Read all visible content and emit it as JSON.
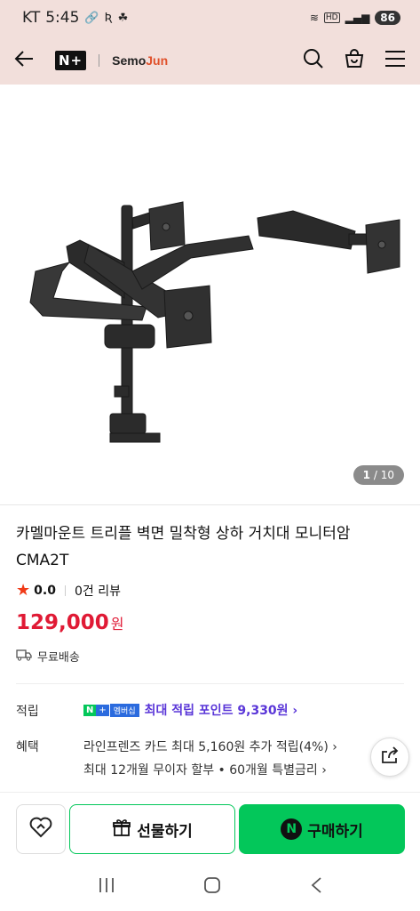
{
  "status_bar": {
    "carrier": "KT",
    "time": "5:45",
    "network": "HD",
    "battery": "86"
  },
  "header": {
    "brand_badge": "N+",
    "brand_name_part1": "Semo",
    "brand_name_part2": "Jun"
  },
  "gallery": {
    "current": "1",
    "total": "/ 10"
  },
  "product": {
    "title": "카멜마운트 트리플 벽면 밀착형 상하 거치대 모니터암 CMA2T",
    "rating": "0.0",
    "reviews": "0건 리뷰",
    "price": "129,000",
    "currency": "원",
    "delivery": "무료배송"
  },
  "points": {
    "label": "적립",
    "badge_n": "N",
    "badge_plus": "+",
    "badge_member": "멤버십",
    "text": "최대 적립 포인트 9,330원 ›"
  },
  "benefits": {
    "label": "혜택",
    "line1": "라인프렌즈 카드 최대 5,160원 추가 적립(4%) ›",
    "line2": "최대 12개월 무이자 할부 • 60개월 특별금리 ›"
  },
  "actions": {
    "gift_label": "선물하기",
    "buy_label": "구매하기",
    "buy_badge": "N"
  },
  "colors": {
    "header_bg": "#f2dfdb",
    "price": "#e01a35",
    "naver_green": "#03c75a",
    "points_purple": "#5a36d8"
  }
}
